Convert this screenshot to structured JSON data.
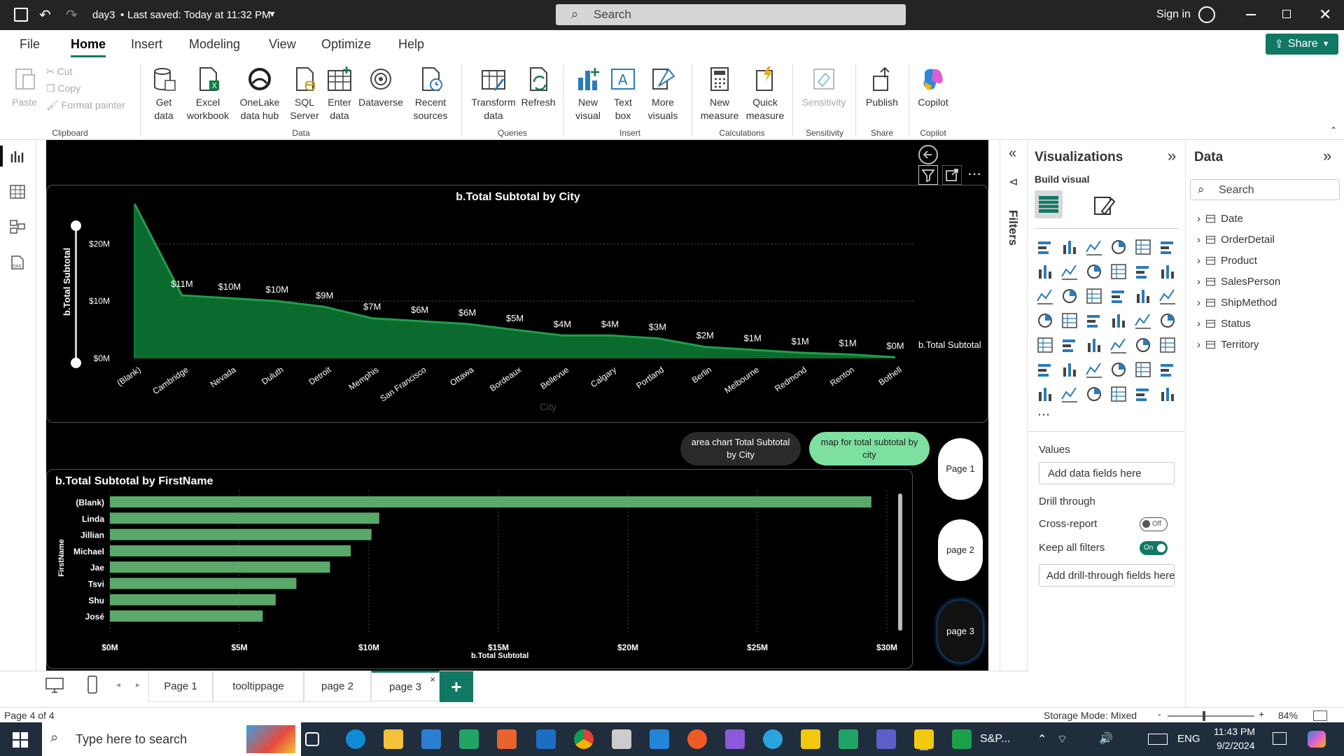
{
  "titlebar": {
    "file_name": "day3",
    "saved_status": "Last saved: Today at 11:32 PM",
    "search_placeholder": "Search",
    "sign_in": "Sign in"
  },
  "menu": {
    "items": [
      "File",
      "Home",
      "Insert",
      "Modeling",
      "View",
      "Optimize",
      "Help"
    ],
    "active": "Home",
    "share_label": "Share"
  },
  "ribbon": {
    "clipboard": {
      "paste": "Paste",
      "cut": "Cut",
      "copy": "Copy",
      "format_painter": "Format painter",
      "group": "Clipboard"
    },
    "data": {
      "get_data": "Get data",
      "excel": "Excel workbook",
      "onelake": "OneLake data hub",
      "sql": "SQL Server",
      "enter": "Enter data",
      "dataverse": "Dataverse",
      "recent": "Recent sources",
      "group": "Data"
    },
    "queries": {
      "transform": "Transform data",
      "refresh": "Refresh",
      "group": "Queries"
    },
    "insert": {
      "new_visual": "New visual",
      "text_box": "Text box",
      "more_visuals": "More visuals",
      "group": "Insert"
    },
    "calculations": {
      "new_measure": "New measure",
      "quick_measure": "Quick measure",
      "group": "Calculations"
    },
    "sensitivity": {
      "label": "Sensitivity",
      "group": "Sensitivity"
    },
    "share": {
      "publish": "Publish",
      "group": "Share"
    },
    "copilot": {
      "label": "Copilot",
      "group": "Copilot"
    }
  },
  "area_chart_labels": {
    "series_label": "b.Total Subtotal",
    "x_axis_title": "City"
  },
  "bar_chart_labels": {
    "y_axis_title": "FirstName"
  },
  "chart_data": [
    {
      "type": "area",
      "title": "b.Total Subtotal by City",
      "ylabel": "b.Total Subtotal",
      "xlabel": "City",
      "categories": [
        "(Blank)",
        "Cambridge",
        "Nevada",
        "Duluth",
        "Detroit",
        "Memphis",
        "San Francisco",
        "Ottawa",
        "Bordeaux",
        "Bellevue",
        "Calgary",
        "Portland",
        "Berlin",
        "Melbourne",
        "Redmond",
        "Renton",
        "Bothell"
      ],
      "values": [
        27,
        11,
        10.5,
        10,
        9,
        7,
        6.5,
        6,
        5,
        4,
        4,
        3.5,
        2,
        1.5,
        1,
        0.7,
        0.2
      ],
      "data_labels": [
        "",
        "$11M",
        "$10M",
        "$10M",
        "$9M",
        "$7M",
        "$6M",
        "$6M",
        "$5M",
        "$4M",
        "$4M",
        "$3M",
        "$2M",
        "$1M",
        "$1M",
        "$1M",
        "$0M"
      ],
      "yticks": [
        "$0M",
        "$10M",
        "$20M"
      ],
      "ylim": [
        0,
        27
      ],
      "legend": "b.Total Subtotal",
      "color": "#1f9e48"
    },
    {
      "type": "bar",
      "title": "b.Total Subtotal by FirstName",
      "ylabel": "FirstName",
      "xlabel": "b.Total Subtotal",
      "categories": [
        "(Blank)",
        "Linda",
        "Jillian",
        "Michael",
        "Jae",
        "Tsvi",
        "Shu",
        "José"
      ],
      "values": [
        29.4,
        10.4,
        10.1,
        9.3,
        8.5,
        7.2,
        6.4,
        5.9
      ],
      "xticks": [
        "$0M",
        "$5M",
        "$10M",
        "$15M",
        "$20M",
        "$25M",
        "$30M"
      ],
      "xlim": [
        0,
        30
      ],
      "color": "#5aa86a"
    }
  ],
  "buttons": {
    "area_chart": "area chart Total Subtotal by City",
    "map": "map for total subtotal by city",
    "page1": "Page 1",
    "page2": "page 2",
    "page3": "page 3"
  },
  "filters_label": "Filters",
  "visualizations": {
    "title": "Visualizations",
    "build_visual": "Build visual",
    "values": "Values",
    "values_placeholder": "Add data fields here",
    "drill_through": "Drill through",
    "cross_report": "Cross-report",
    "cross_report_state": "Off",
    "keep_all_filters": "Keep all filters",
    "keep_all_filters_state": "On",
    "drill_placeholder": "Add drill-through fields here"
  },
  "data_pane": {
    "title": "Data",
    "search_placeholder": "Search",
    "tables": [
      "Date",
      "OrderDetail",
      "Product",
      "SalesPerson",
      "ShipMethod",
      "Status",
      "Territory"
    ]
  },
  "tabs": {
    "items": [
      "Page 1",
      "tooltippage",
      "page 2",
      "page 3"
    ],
    "active": "page 3",
    "add": "+"
  },
  "status": {
    "page": "Page 4 of 4",
    "storage": "Storage Mode: Mixed",
    "zoom": "84%"
  },
  "taskbar": {
    "search_placeholder": "Type here to search",
    "app_label": "S&P...",
    "lang": "ENG",
    "time": "11:43 PM",
    "date": "9/2/2024"
  },
  "colors": {
    "accent_green": "#117865",
    "area_fill": "#0b6b2e",
    "bar_fill": "#5aa86a",
    "button_green": "#7ee0a0"
  }
}
